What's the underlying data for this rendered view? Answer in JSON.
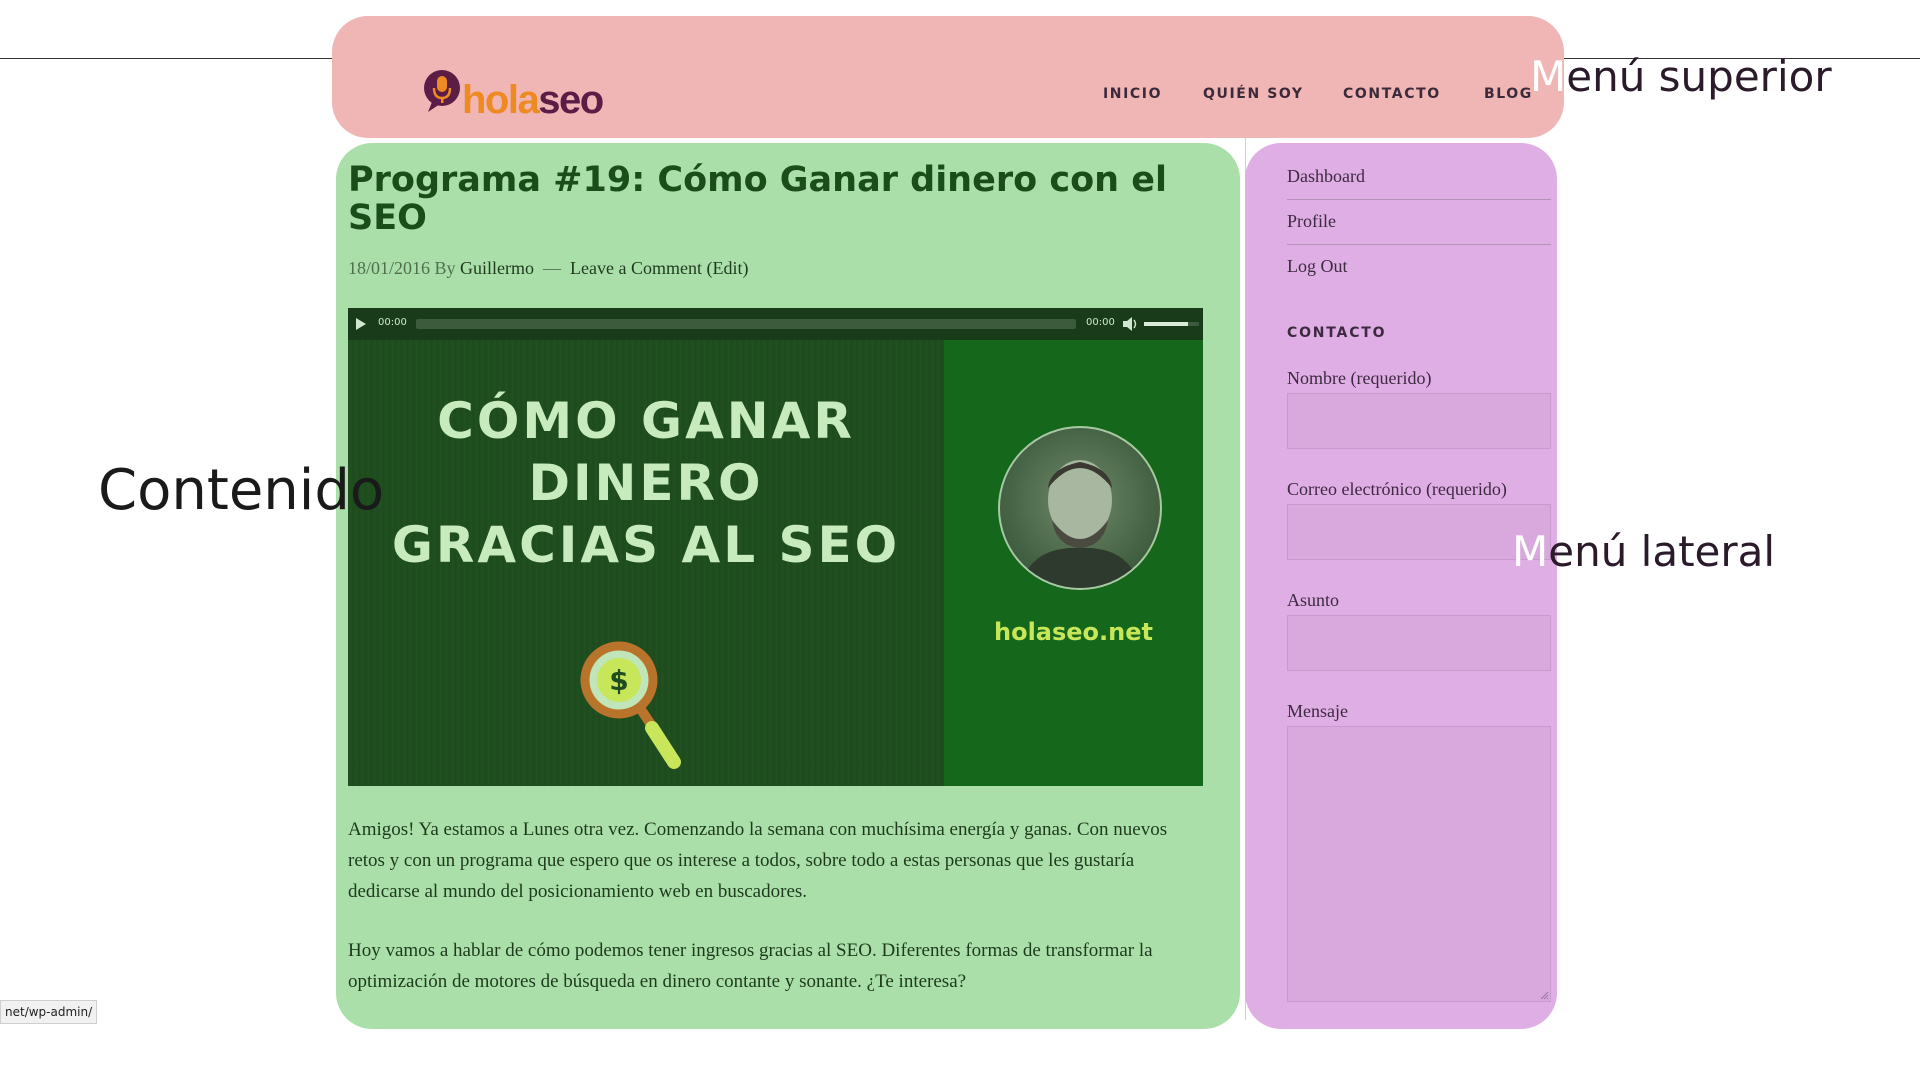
{
  "header": {
    "logo": {
      "text_hola": "hola",
      "text_seo": "seo"
    },
    "nav": [
      {
        "label": "INICIO"
      },
      {
        "label": "QUIÉN SOY"
      },
      {
        "label": "CONTACTO"
      },
      {
        "label": "BLOG"
      }
    ]
  },
  "post": {
    "title": "Programa #19: Cómo Ganar dinero con el SEO",
    "meta": {
      "date": "18/01/2016",
      "by": "By",
      "author": "Guillermo",
      "separator": "—",
      "comment_link": "Leave a Comment",
      "edit_link": "(Edit)"
    },
    "audio_player": {
      "current_time": "00:00",
      "duration": "00:00",
      "volume_level": 0.8
    },
    "featured_image": {
      "headline_lines": [
        "CÓMO GANAR",
        "DINERO",
        "GRACIAS AL SEO"
      ],
      "brand_url": "holaseo.net",
      "icon": "magnifier-dollar-icon"
    },
    "paragraphs": [
      "Amigos! Ya estamos a Lunes otra vez. Comenzando la semana con muchísima energía y ganas. Con nuevos retos y con un programa que espero que os interese a todos, sobre todo a estas personas que les gustaría dedicarse al mundo del posicionamiento web en buscadores.",
      "Hoy vamos a hablar de cómo podemos tener ingresos gracias al SEO. Diferentes formas de transformar la optimización de motores de búsqueda en dinero contante y sonante. ¿Te interesa?"
    ]
  },
  "sidebar": {
    "meta_links": [
      {
        "label": "Dashboard"
      },
      {
        "label": "Profile"
      },
      {
        "label": "Log Out"
      }
    ],
    "contact_widget": {
      "title": "CONTACTO",
      "fields": [
        {
          "label": "Nombre (requerido)",
          "value": ""
        },
        {
          "label": "Correo electrónico (requerido)",
          "value": ""
        },
        {
          "label": "Asunto",
          "value": ""
        },
        {
          "label": "Mensaje",
          "value": ""
        }
      ]
    }
  },
  "annotations": {
    "top_menu": {
      "first": "M",
      "rest": "enú superior"
    },
    "content": {
      "text": "Contenido"
    },
    "side_menu": {
      "first": "M",
      "rest": "enú lateral"
    }
  },
  "status_bar": {
    "url": "net/wp-admin/"
  },
  "colors": {
    "top_region": "#f0b5b5",
    "content_region": "#abdfa9",
    "side_region": "#dfaee4",
    "logo_orange": "#ee8a22",
    "logo_purple": "#5b1d45"
  }
}
